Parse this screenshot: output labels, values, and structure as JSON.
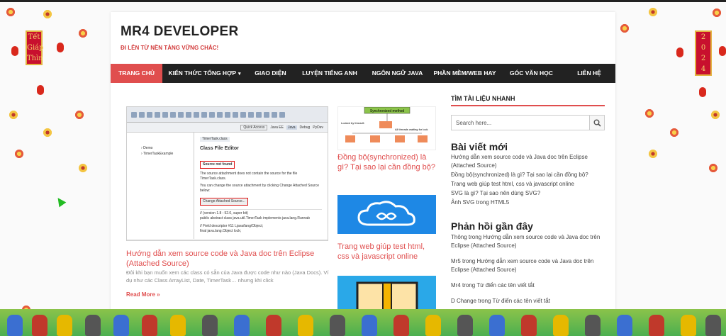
{
  "site": {
    "title": "MR4 DEVELOPER",
    "tagline": "ĐI LÊN TỪ NỀN TẢNG VỮNG CHẮC!"
  },
  "nav": [
    {
      "label": "TRANG CHỦ",
      "active": true
    },
    {
      "label": "KIẾN THỨC TỔNG HỢP",
      "has_dropdown": true
    },
    {
      "label": "GIAO DIỆN"
    },
    {
      "label": "LUYỆN TIẾNG ANH"
    },
    {
      "label": "NGÔN NGỮ JAVA"
    },
    {
      "label": "PHẦN MỀM/WEB HAY"
    },
    {
      "label": "GÓC VĂN HỌC"
    },
    {
      "label": "LIÊN HỆ"
    }
  ],
  "main_post": {
    "title": "Hướng dẫn xem source code và Java doc trên Eclipse (Attached Source)",
    "excerpt": "Đôi khi bạn muốn xem các class có sẵn của Java được code như nào (Java Docs). Ví dụ như các Class ArrayList, Date, TimerTask… nhưng khi click",
    "read_more": "Read More »",
    "screenshot": {
      "quick_access": "Quick Access",
      "tab_java_ee": "Java EE",
      "tab_java": "Java",
      "tab_debug": "Debug",
      "tab_pydev": "PyDev",
      "file_tab": "TimerTask.class",
      "tree_items": [
        "Demo",
        "TimerTaskExample"
      ],
      "editor_title": "Class File Editor",
      "source_not_found": "Source not found",
      "desc1": "The source attachment does not contain the source for the file TimerTask.class.",
      "desc2": "You can change the source attachment by clicking Change Attached Source below:",
      "change_btn": "Change Attached Source...",
      "code1": "// (version 1.8 : 52.0, super bit)",
      "code2": "public abstract class java.util.TimerTask implements java.lang.Runnab",
      "code3": "// Field descriptor #11 Ljava/lang/Object;",
      "code4": "final java.lang.Object lock;"
    }
  },
  "side_posts": [
    {
      "title": "Đồng bộ(synchronized) là gì? Tại sao lại cần đồng bộ?",
      "thumb": {
        "label1": "Synchronized method",
        "label2": "Locked by thread1",
        "label3": "All threads waiting for lock"
      }
    },
    {
      "title": "Trang web giúp test html, css và javascript online"
    }
  ],
  "sidebar": {
    "search_title": "TÌM TÀI LIỆU NHANH",
    "search_placeholder": "Search here...",
    "recent_title": "Bài viết mới",
    "recent": [
      "Hướng dẫn xem source code và Java doc trên Eclipse (Attached Source)",
      "Đồng bộ(synchronized) là gì? Tại sao lại cần đồng bộ?",
      "Trang web giúp test html, css và javascript online",
      "SVG là gì? Tại sao nên dùng SVG?",
      "Ảnh SVG trong HTML5"
    ],
    "comments_title": "Phản hồi gần đây",
    "comments": [
      "Thông trong Hướng dẫn xem source code và Java doc trên Eclipse (Attached Source)",
      "Mr5 trong Hướng dẫn xem source code và Java doc trên Eclipse (Attached Source)",
      "Mr4 trong Từ điển các tên viết tắt",
      "D Change trong Từ điển các tên viết tắt"
    ]
  },
  "decor": {
    "left_banner": [
      "Tết",
      "Giáp",
      "Thìn"
    ],
    "right_banner": [
      "2",
      "0",
      "2",
      "4"
    ]
  },
  "colors": {
    "accent": "#e04e4e",
    "nav_bg": "#222222",
    "link": "#e04e4e"
  }
}
